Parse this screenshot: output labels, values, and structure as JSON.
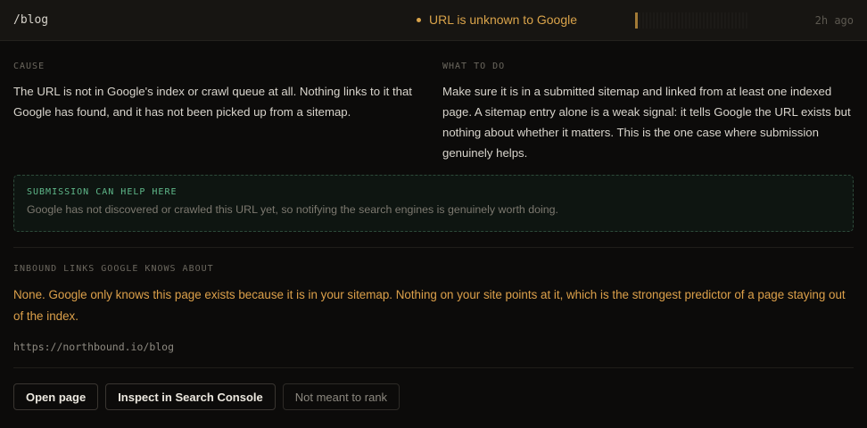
{
  "header": {
    "path": "/blog",
    "status_text": "URL is unknown to Google",
    "status_color": "#d9a34a",
    "age": "2h ago"
  },
  "cause": {
    "label": "CAUSE",
    "text": "The URL is not in Google's index or crawl queue at all. Nothing links to it that Google has found, and it has not been picked up from a sitemap."
  },
  "todo": {
    "label": "WHAT TO DO",
    "text": "Make sure it is in a submitted sitemap and linked from at least one indexed page. A sitemap entry alone is a weak signal: it tells Google the URL exists but nothing about whether it matters. This is the one case where submission genuinely helps."
  },
  "callout": {
    "title": "SUBMISSION CAN HELP HERE",
    "text": "Google has not discovered or crawled this URL yet, so notifying the search engines is genuinely worth doing."
  },
  "inbound": {
    "label": "INBOUND LINKS GOOGLE KNOWS ABOUT",
    "text": "None. Google only knows this page exists because it is in your sitemap. Nothing on your site points at it, which is the strongest predictor of a page staying out of the index.",
    "url": "https://northbound.io/blog"
  },
  "actions": {
    "open": "Open page",
    "inspect": "Inspect in Search Console",
    "dismiss": "Not meant to rank"
  }
}
